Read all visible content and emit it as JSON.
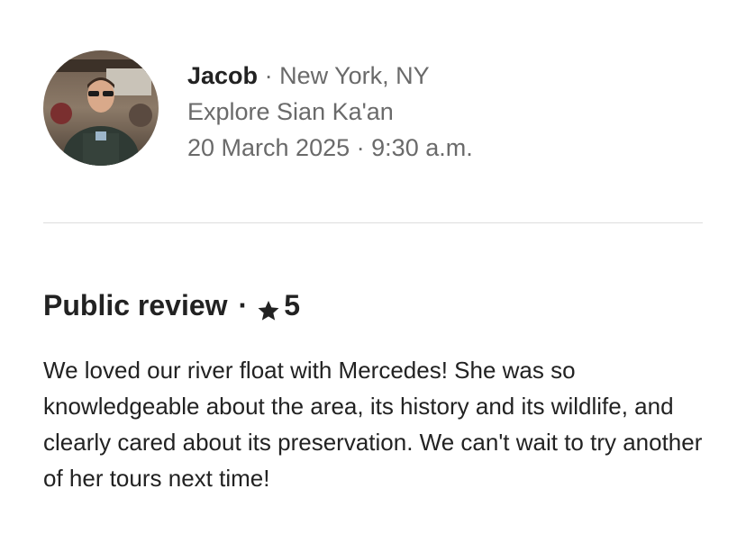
{
  "reviewer": {
    "name": "Jacob",
    "separator": "·",
    "location": "New York, NY",
    "experience": "Explore Sian Ka'an",
    "date": "20 March 2025",
    "time": "9:30 a.m."
  },
  "review": {
    "title": "Public review",
    "separator": "·",
    "rating": "5",
    "rating_icon": "star-icon",
    "text": "We loved our river float with Mercedes! She was so knowledgeable about the area, its history and its wildlife, and clearly cared about its preservation. We can't wait to try another of her tours next time!"
  },
  "colors": {
    "primary_text": "#222222",
    "secondary_text": "#6a6a6a",
    "divider": "#dddddd"
  }
}
